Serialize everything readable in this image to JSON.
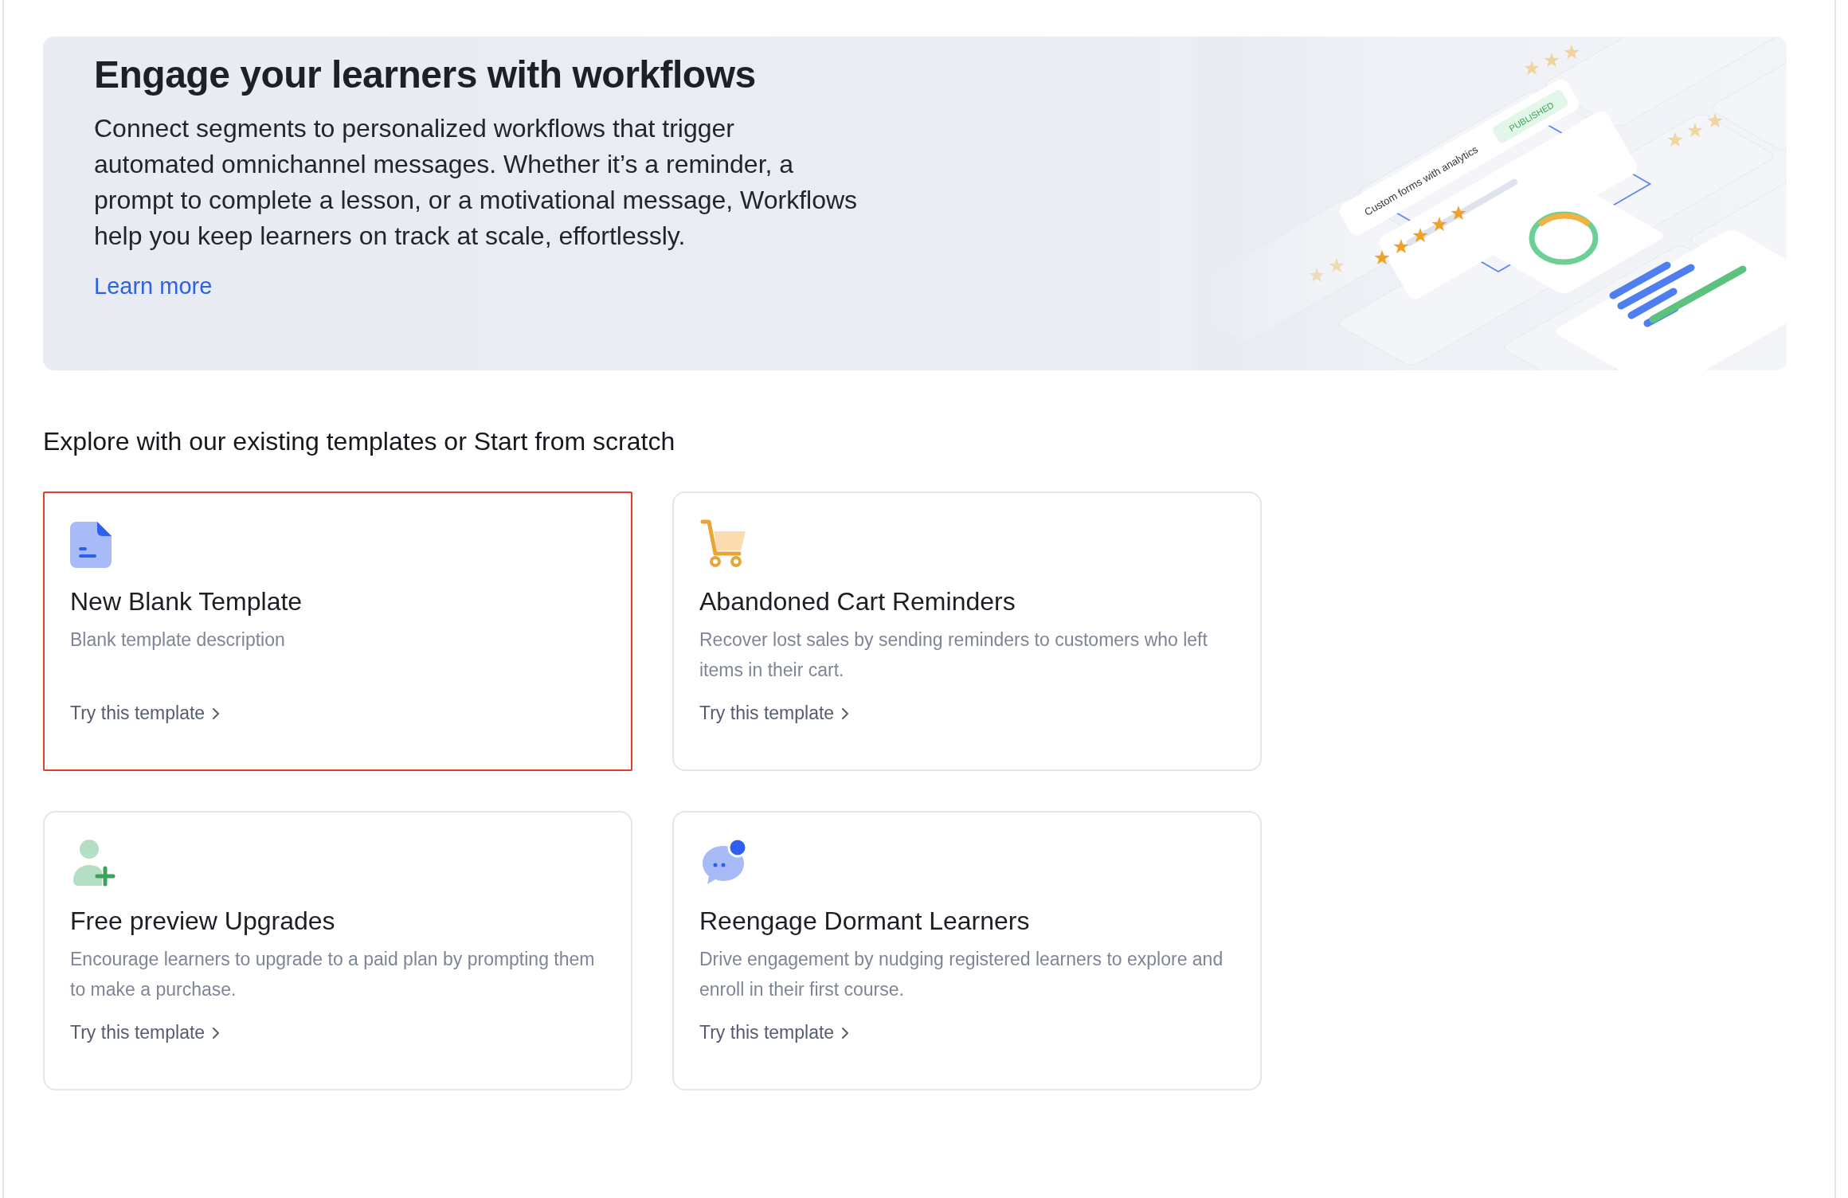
{
  "banner": {
    "title": "Engage your learners with workflows",
    "description": "Connect segments to personalized workflows that trigger automated omnichannel messages. Whether it’s a reminder, a prompt to complete a lesson, or a motivational message, Workflows help you keep learners on track at scale, effortlessly.",
    "link": "Learn more",
    "illustration": {
      "form_label": "Custom forms with analytics",
      "badge": "PUBLISHED"
    }
  },
  "section_title": "Explore with our existing templates or Start from scratch",
  "templates": [
    {
      "kind": "document",
      "title": "New Blank Template",
      "description": "Blank template description",
      "action": "Try this template",
      "selected": true
    },
    {
      "kind": "cart",
      "title": "Abandoned Cart Reminders",
      "description": "Recover lost sales by sending reminders to customers who left items in their cart.",
      "action": "Try this template",
      "selected": false
    },
    {
      "kind": "user-add",
      "title": "Free preview Upgrades",
      "description": "Encourage learners to upgrade to a paid plan by prompting them to make a purchase.",
      "action": "Try this template",
      "selected": false
    },
    {
      "kind": "chat",
      "title": "Reengage Dormant Learners",
      "description": "Drive engagement by nudging registered learners to explore and enroll in their first course.",
      "action": "Try this template",
      "selected": false
    }
  ]
}
